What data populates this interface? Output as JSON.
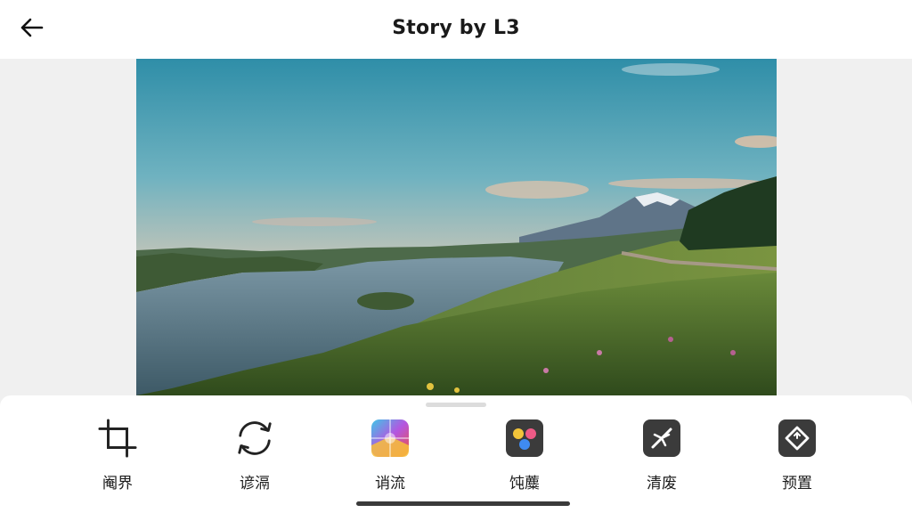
{
  "header": {
    "title": "Story by L3",
    "back_icon": "arrow-left-icon"
  },
  "photo": {
    "description_icon": "landscape-photo"
  },
  "tools": [
    {
      "id": "crop",
      "label": "阉界",
      "icon": "crop-icon"
    },
    {
      "id": "rotate",
      "label": "谚滆",
      "icon": "rotate-icon"
    },
    {
      "id": "filters",
      "label": "诮流",
      "icon": "filters-icon"
    },
    {
      "id": "colors",
      "label": "饨蘪",
      "icon": "palette-icon"
    },
    {
      "id": "cutout",
      "label": "清废",
      "icon": "magic-wand-icon"
    },
    {
      "id": "adjust",
      "label": "预置",
      "icon": "adjust-icon"
    }
  ],
  "colors": {
    "accent_dark": "#3b3b3b",
    "text": "#1c1c1c"
  }
}
